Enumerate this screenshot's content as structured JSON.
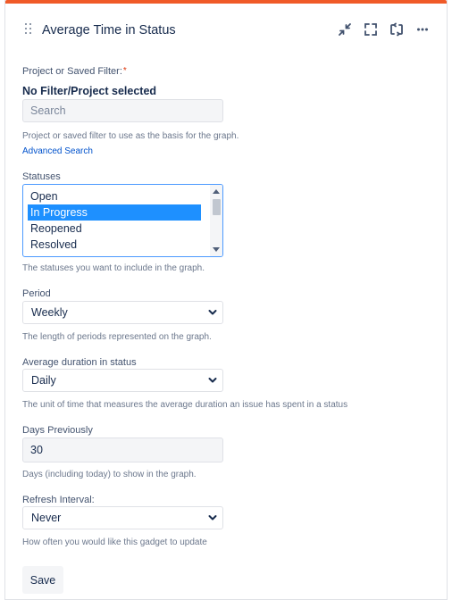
{
  "gadget": {
    "title": "Average Time in Status",
    "icons": [
      "minimize-icon",
      "fullscreen-icon",
      "refresh-icon",
      "more-icon"
    ]
  },
  "filter": {
    "label": "Project or Saved Filter:",
    "required_mark": "*",
    "selected_text": "No Filter/Project selected",
    "search_placeholder": "Search",
    "help": "Project or saved filter to use as the basis for the graph.",
    "advanced_link": "Advanced Search"
  },
  "statuses": {
    "label": "Statuses",
    "options": [
      "Open",
      "In Progress",
      "Reopened",
      "Resolved"
    ],
    "selected": "In Progress",
    "help": "The statuses you want to include in the graph."
  },
  "period": {
    "label": "Period",
    "value": "Weekly",
    "help": "The length of periods represented on the graph."
  },
  "average_duration": {
    "label": "Average duration in status",
    "value": "Daily",
    "help": "The unit of time that measures the average duration an issue has spent in a status"
  },
  "days_previously": {
    "label": "Days Previously",
    "value": "30",
    "help": "Days (including today) to show in the graph."
  },
  "refresh": {
    "label": "Refresh Interval:",
    "value": "Never",
    "help": "How often you would like this gadget to update"
  },
  "save_label": "Save",
  "colors": {
    "accent_bar": "#f05a28",
    "link": "#0052cc",
    "selection": "#1e90ff",
    "focus_border": "#4c9aff"
  }
}
